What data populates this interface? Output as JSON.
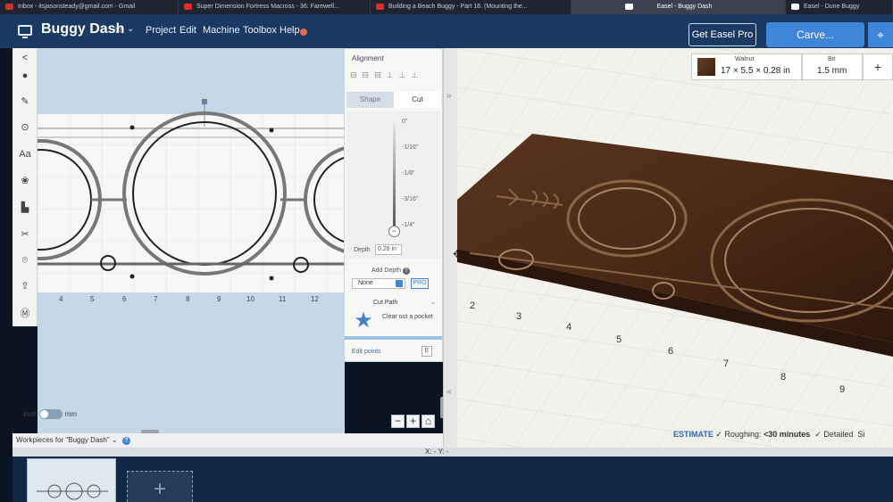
{
  "browser": {
    "tabs": [
      {
        "label": "Inbox - itsjasonsteady@gmail.com - Gmail",
        "favicon": "gmail-icon",
        "color": "#c5372c"
      },
      {
        "label": "Super Dimension Fortress Macross - 36: Farewell...",
        "favicon": "youtube-icon",
        "color": "#e52d27"
      },
      {
        "label": "Building a Beach Buggy - Part 16. (Mounting the...",
        "favicon": "youtube-icon",
        "color": "#e52d27"
      },
      {
        "label": "Easel - Buggy Dash",
        "favicon": "easel-icon",
        "color": "#ffffff",
        "active": true
      },
      {
        "label": "Easel - Dune Buggy",
        "favicon": "easel-icon",
        "color": "#ffffff"
      }
    ]
  },
  "header": {
    "title": "Buggy Dash",
    "star": "☆",
    "chevron": "⌄",
    "menu": [
      "Project",
      "Edit",
      "Machine",
      "Toolbox",
      "Help"
    ],
    "help_dot_color": "#e86a4b",
    "pro_button": "Get Easel Pro",
    "carve_button": "Carve...",
    "side_button": "⌖"
  },
  "tools": [
    {
      "name": "collapse-icon",
      "glyph": "<"
    },
    {
      "name": "shapes-icon",
      "glyph": "●"
    },
    {
      "name": "pen-icon",
      "glyph": "✎"
    },
    {
      "name": "target-icon",
      "glyph": "⊙"
    },
    {
      "name": "text-icon",
      "glyph": "Aa"
    },
    {
      "name": "palette-icon",
      "glyph": "❀"
    },
    {
      "name": "ruler-icon",
      "glyph": "▙"
    },
    {
      "name": "scissors-icon",
      "glyph": "✂"
    },
    {
      "name": "camera-icon",
      "glyph": "⌾"
    },
    {
      "name": "upload-icon",
      "glyph": "⇧"
    },
    {
      "name": "m-logo-icon",
      "glyph": "Ⓜ"
    }
  ],
  "design": {
    "ruler": [
      "4",
      "5",
      "6",
      "7",
      "8",
      "9",
      "10",
      "11",
      "12"
    ],
    "units": {
      "left": "inch",
      "right": "mm"
    },
    "zoom": [
      "−",
      "+",
      "⌂"
    ]
  },
  "panel": {
    "alignment": "Alignment",
    "align_icons": "⊟⊟⊟⊥⊥⊥",
    "tab_shape": "Shape",
    "tab_cut": "Cut",
    "ticks": [
      "0\"",
      "-1/16\"",
      "-1/8\"",
      "-3/16\"",
      "-1/4\""
    ],
    "depth_label": "Depth",
    "depth_value": "0.28 in",
    "add_depth": "Add Depth",
    "add_depth_value": "None",
    "pro_badge": "PRO",
    "cut_path": "Cut Path",
    "cut_desc": "Clear out a pocket",
    "edit_points": "Edit points",
    "edit_key": "E"
  },
  "material": {
    "name": "Walnut",
    "dims": "17 × 5.5 × 0.28 in",
    "bit_label": "Bit",
    "bit_value": "1.5 mm",
    "plus": "+"
  },
  "preview": {
    "axis": [
      "2",
      "3",
      "4",
      "5",
      "6",
      "7",
      "8",
      "9"
    ]
  },
  "estimate": {
    "link": "ESTIMATE",
    "roughing_label": "Roughing:",
    "roughing_value": "<30 minutes",
    "detailed": "Detailed",
    "extra": "Si"
  },
  "workpieces": {
    "label": "Workpieces for \"Buggy Dash\"",
    "chevron": "⌄",
    "help": "?",
    "add": "+"
  },
  "coords": "X: -  Y: -"
}
